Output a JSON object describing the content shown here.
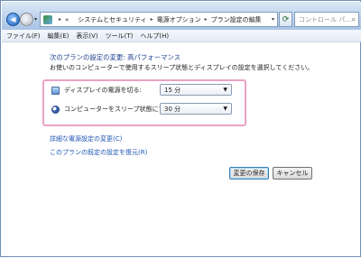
{
  "nav": {
    "breadcrumb": [
      "«",
      "システムとセキュリティ",
      "電源オプション",
      "プラン設定の編集"
    ],
    "search_placeholder": "コントロール パ..."
  },
  "menu": [
    {
      "label": "ファイル(F)"
    },
    {
      "label": "編集(E)"
    },
    {
      "label": "表示(V)"
    },
    {
      "label": "ツール(T)"
    },
    {
      "label": "ヘルプ(H)"
    }
  ],
  "main": {
    "heading": "次のプランの設定の変更: 高パフォーマンス",
    "description": "お使いのコンピューターで使用するスリープ状態とディスプレイの設定を選択してください。",
    "settings": [
      {
        "icon": "display-icon",
        "label": "ディスプレイの電源を切る:",
        "value": "15 分"
      },
      {
        "icon": "sleep-icon",
        "label": "コンピューターをスリープ状態にする:",
        "value": "30 分"
      }
    ],
    "links": {
      "advanced": "詳細な電源設定の変更(C)",
      "restore": "このプランの既定の設定を復元(R)"
    },
    "buttons": {
      "save": "変更の保存",
      "cancel": "キャンセル"
    }
  },
  "colors": {
    "accent_link": "#1e55b5",
    "highlight_frame": "#e9a3c3"
  }
}
